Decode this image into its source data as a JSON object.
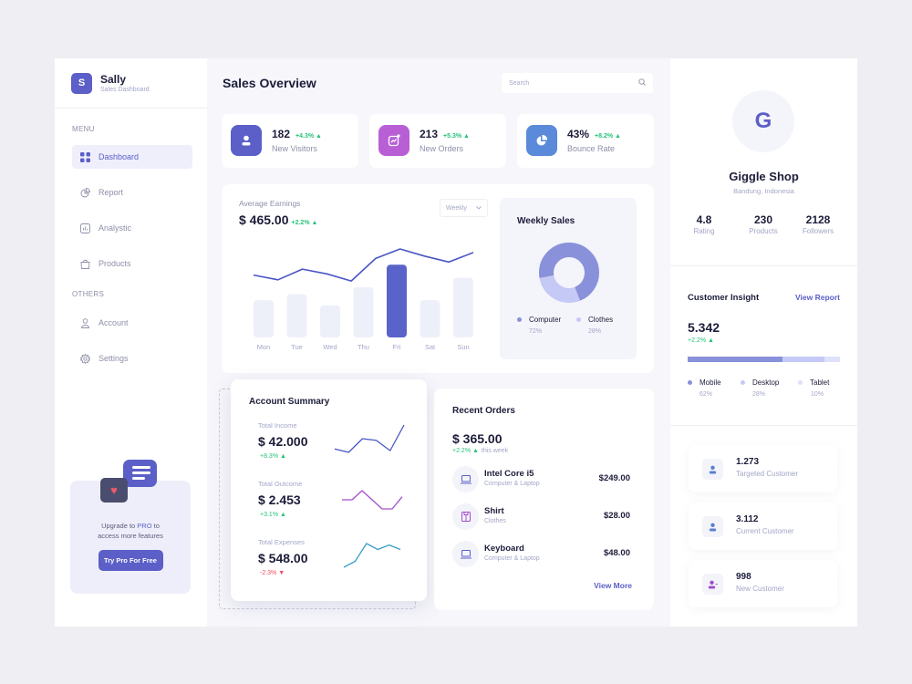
{
  "sidebar": {
    "brand_initial": "S",
    "brand_name": "Sally",
    "brand_subtitle": "Sales Dashboard",
    "menu_label": "MENU",
    "others_label": "OTHERS",
    "menu_items": [
      {
        "label": "Dashboard",
        "icon": "grid-icon",
        "active": true
      },
      {
        "label": "Report",
        "icon": "pie-chart-icon"
      },
      {
        "label": "Analystic",
        "icon": "bar-chart-icon"
      },
      {
        "label": "Products",
        "icon": "shopping-bag-icon"
      }
    ],
    "other_items": [
      {
        "label": "Account",
        "icon": "user-icon"
      },
      {
        "label": "Settings",
        "icon": "gear-icon"
      }
    ],
    "promo": {
      "text_before": "Upgrade to ",
      "text_highlight": "PRO",
      "text_after": " to",
      "text_line2": "access more features",
      "button_label": "Try Pro For Free"
    }
  },
  "header": {
    "title": "Sales Overview",
    "search_placeholder": "Search"
  },
  "stats": [
    {
      "value": "182",
      "change": "+4.3% ▲",
      "label": "New Visitors",
      "icon": "user-icon",
      "color": "#5b5fc7"
    },
    {
      "value": "213",
      "change": "+5.3% ▲",
      "label": "New Orders",
      "icon": "trend-image-icon",
      "color": "#b85fd6"
    },
    {
      "value": "43%",
      "change": "+8.2% ▲",
      "label": "Bounce Rate",
      "icon": "pie-chart-icon",
      "color": "#5a8ad9"
    }
  ],
  "earnings": {
    "label": "Average Earnings",
    "value": "$ 465.00",
    "change": "+2.2% ▲",
    "period": "Weekly",
    "days": [
      "Mon",
      "Tue",
      "Wed",
      "Thu",
      "Fri",
      "Sat",
      "Sun"
    ],
    "bar_values": [
      43,
      50,
      37,
      58,
      84,
      43,
      69
    ],
    "line_values": [
      58,
      54,
      63,
      59,
      53,
      72,
      80,
      74,
      69,
      77
    ],
    "highlight_day": "Fri"
  },
  "weekly_sales": {
    "title": "Weekly Sales",
    "segments": [
      {
        "label": "Computer",
        "percent_text": "72%",
        "value": 72,
        "color": "#8891d9"
      },
      {
        "label": "Clothes",
        "percent_text": "28%",
        "value": 28,
        "color": "#c5c9f5"
      }
    ]
  },
  "account_summary": {
    "title": "Account Summary",
    "items": [
      {
        "label": "Total Income",
        "value": "$ 42.000",
        "change": "+8.3% ▲",
        "positive": true,
        "color": "#4a56c4",
        "spark": [
          3,
          2,
          6,
          5.5,
          2.5,
          10
        ]
      },
      {
        "label": "Total Outcome",
        "value": "$ 2.453",
        "change": "+3.1% ▲",
        "positive": true,
        "color": "#a24fc9",
        "spark": [
          5,
          5,
          8,
          5,
          2,
          2,
          6
        ]
      },
      {
        "label": "Total Expenses",
        "value": "$ 548.00",
        "change": "-2.3% ▼",
        "positive": false,
        "color": "#3a9ec9",
        "spark": [
          1,
          3,
          9,
          7,
          8.5,
          7
        ]
      }
    ]
  },
  "recent_orders": {
    "title": "Recent Orders",
    "total": "$ 365.00",
    "change": "+2.2% ▲",
    "change_suffix": "this week",
    "items": [
      {
        "name": "Intel Core i5",
        "category": "Computer & Laptop",
        "price": "$249.00",
        "icon": "laptop-icon"
      },
      {
        "name": "Shirt",
        "category": "Clothes",
        "price": "$28.00",
        "icon": "shirt-icon"
      },
      {
        "name": "Keyboard",
        "category": "Computer & Laptop",
        "price": "$48.00",
        "icon": "laptop-icon"
      }
    ],
    "view_more": "View More"
  },
  "profile": {
    "initial": "G",
    "name": "Giggle Shop",
    "location": "Bandung, Indonesia",
    "stats": [
      {
        "value": "4.8",
        "label": "Rating"
      },
      {
        "value": "230",
        "label": "Products"
      },
      {
        "value": "2128",
        "label": "Followers"
      }
    ]
  },
  "customer_insight": {
    "title": "Customer Insight",
    "link": "View Report",
    "value": "5.342",
    "change": "+2.2% ▲",
    "segments": [
      {
        "label": "Mobile",
        "percent_text": "62%",
        "value": 62,
        "color": "#8891d9"
      },
      {
        "label": "Desktop",
        "percent_text": "28%",
        "value": 28,
        "color": "#c5c9f5"
      },
      {
        "label": "Tablet",
        "percent_text": "10%",
        "value": 10,
        "color": "#dfe1fa"
      }
    ]
  },
  "customers": [
    {
      "value": "1.273",
      "label": "Targeted Customer",
      "color": "#5a7fd0",
      "icon": "user-icon"
    },
    {
      "value": "3.112",
      "label": "Current Customer",
      "color": "#5a7fd0",
      "icon": "user-icon"
    },
    {
      "value": "998",
      "label": "New Customer",
      "color": "#a24fc9",
      "icon": "user-plus-icon"
    }
  ]
}
